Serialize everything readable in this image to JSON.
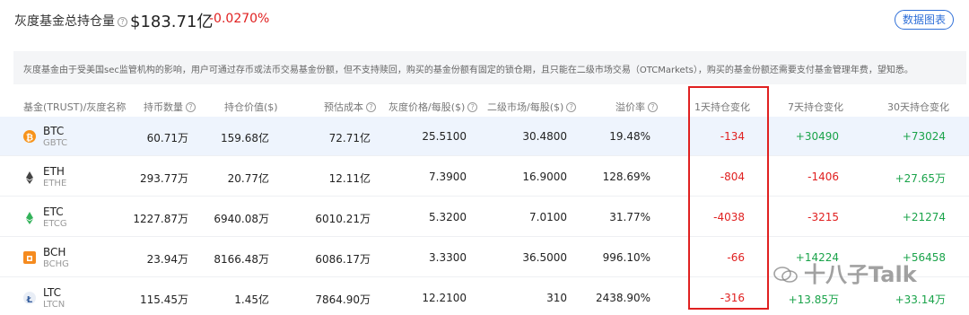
{
  "header": {
    "title": "灰度基金总持仓量",
    "total": "$183.71亿",
    "change": "-0.0270%",
    "data_chart_button": "数据图表"
  },
  "notice": "灰度基金由于受美国sec监管机构的影响，用户可通过存币或法币交易基金份额，但不支持赎回，购买的基金份额有固定的锁仓期，且只能在二级市场交易（OTCMarkets），购买的基金份额还需要支付基金管理年费，望知悉。",
  "columns": {
    "name": "基金(TRUST)/灰度名称",
    "holdings": "持币数量",
    "holding_value": "持仓价值($)",
    "est_cost": "预估成本",
    "gray_price": "灰度价格/每股($)",
    "secondary_price": "二级市场/每股($)",
    "premium": "溢价率",
    "d1": "1天持仓变化",
    "d7": "7天持仓变化",
    "d30": "30天持仓变化"
  },
  "rows": [
    {
      "symbol": "BTC",
      "trust": "GBTC",
      "icon": "btc-icon",
      "color": "#f7931a",
      "holdings": "60.71万",
      "value": "159.68亿",
      "cost": "72.71亿",
      "gray_price": "25.5100",
      "secondary": "30.4800",
      "premium": "19.48%",
      "d1": "-134",
      "d7": "+30490",
      "d30": "+73024"
    },
    {
      "symbol": "ETH",
      "trust": "ETHE",
      "icon": "eth-icon",
      "color": "#444444",
      "holdings": "293.77万",
      "value": "20.77亿",
      "cost": "12.11亿",
      "gray_price": "7.3900",
      "secondary": "16.9000",
      "premium": "128.69%",
      "d1": "-804",
      "d7": "-1406",
      "d30": "+27.65万"
    },
    {
      "symbol": "ETC",
      "trust": "ETCG",
      "icon": "etc-icon",
      "color": "#33b25a",
      "holdings": "1227.87万",
      "value": "6940.08万",
      "cost": "6010.21万",
      "gray_price": "5.3200",
      "secondary": "7.0100",
      "premium": "31.77%",
      "d1": "-4038",
      "d7": "-3215",
      "d30": "+21274"
    },
    {
      "symbol": "BCH",
      "trust": "BCHG",
      "icon": "bch-icon",
      "color": "#f58b1f",
      "holdings": "23.94万",
      "value": "8166.48万",
      "cost": "6086.17万",
      "gray_price": "3.3300",
      "secondary": "36.5000",
      "premium": "996.10%",
      "d1": "-66",
      "d7": "+14224",
      "d30": "+56458"
    },
    {
      "symbol": "LTC",
      "trust": "LTCN",
      "icon": "ltc-icon",
      "color": "#345d9d",
      "holdings": "115.45万",
      "value": "1.45亿",
      "cost": "7864.90万",
      "gray_price": "12.2100",
      "secondary": "310",
      "premium": "2438.90%",
      "d1": "-316",
      "d7": "+13.85万",
      "d30": "+33.14万"
    }
  ],
  "watermark": "十八子Talk",
  "colors": {
    "negative": "#e02020",
    "positive": "#1aa34a",
    "accent": "#2f6fd8",
    "highlight_box": "#e02020"
  }
}
